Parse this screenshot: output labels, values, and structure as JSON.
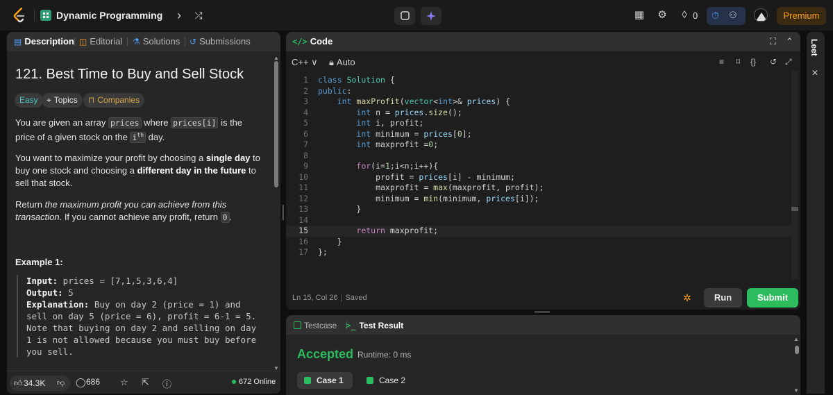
{
  "navbar": {
    "list_title": "Dynamic Programming",
    "prev_icon": "chevron-left-icon",
    "next_icon": "chevron-right-icon",
    "shuffle_icon": "shuffle-icon",
    "streak_count": "0",
    "premium_label": "Premium",
    "premium_color": "#ffa116"
  },
  "left_tabs": {
    "description": "Description",
    "editorial": "Editorial",
    "solutions": "Solutions",
    "submissions": "Submissions"
  },
  "problem": {
    "title": "121. Best Time to Buy and Sell Stock",
    "difficulty": "Easy",
    "topics": "Topics",
    "companies": "Companies",
    "p1_a": "You are given an array ",
    "p1_code1": "prices",
    "p1_b": " where ",
    "p1_code2": "prices[i]",
    "p1_c": " is the price of a given stock on the ",
    "p1_code3": "i",
    "p1_sup": "th",
    "p1_d": " day.",
    "p2_a": "You want to maximize your profit by choosing a ",
    "p2_b": "single day",
    "p2_c": " to buy one stock and choosing a ",
    "p2_d": "different day in the future",
    "p2_e": " to sell that stock.",
    "p3_a": "Return ",
    "p3_b": "the maximum profit you can achieve from this transaction",
    "p3_c": ". If you cannot achieve any profit, return ",
    "p3_code": "0",
    "p3_d": "."
  },
  "example": {
    "title": "Example 1:",
    "input_label": "Input:",
    "input_value": " prices = [7,1,5,3,6,4]",
    "output_label": "Output:",
    "output_value": " 5",
    "explanation_label": "Explanation:",
    "explanation_value": " Buy on day 2 (price = 1) and sell on day 5 (price = 6), profit = 6-1 = 5.",
    "note": "Note that buying on day 2 and selling on day 1 is not allowed because you must buy before you sell."
  },
  "footer": {
    "likes": "34.3K",
    "comments": "686",
    "online": "672 Online"
  },
  "code_panel": {
    "title": "Code",
    "language": "C++ ∨",
    "mode": "Auto",
    "status_pos": "Ln 15, Col 26",
    "status_saved": "Saved",
    "run_label": "Run",
    "submit_label": "Submit",
    "current_line": 15
  },
  "code_lines": [
    "class Solution {",
    "public:",
    "    int maxProfit(vector<int>& prices) {",
    "        int n = prices.size();",
    "        int i, profit;",
    "        int minimum = prices[0];",
    "        int maxprofit =0;",
    "",
    "        for(i=1;i<n;i++){",
    "            profit = prices[i] - minimum;",
    "            maxprofit = max(maxprofit, profit);",
    "            minimum = min(minimum, prices[i]);",
    "        }",
    "",
    "        return maxprofit;",
    "    }",
    "};"
  ],
  "result": {
    "testcase_tab": "Testcase",
    "result_tab": "Test Result",
    "verdict": "Accepted",
    "runtime": "Runtime: 0 ms",
    "case1": "Case 1",
    "case2": "Case 2",
    "accent": "#2cbb5d"
  },
  "side_panel": {
    "label": "Leet"
  }
}
